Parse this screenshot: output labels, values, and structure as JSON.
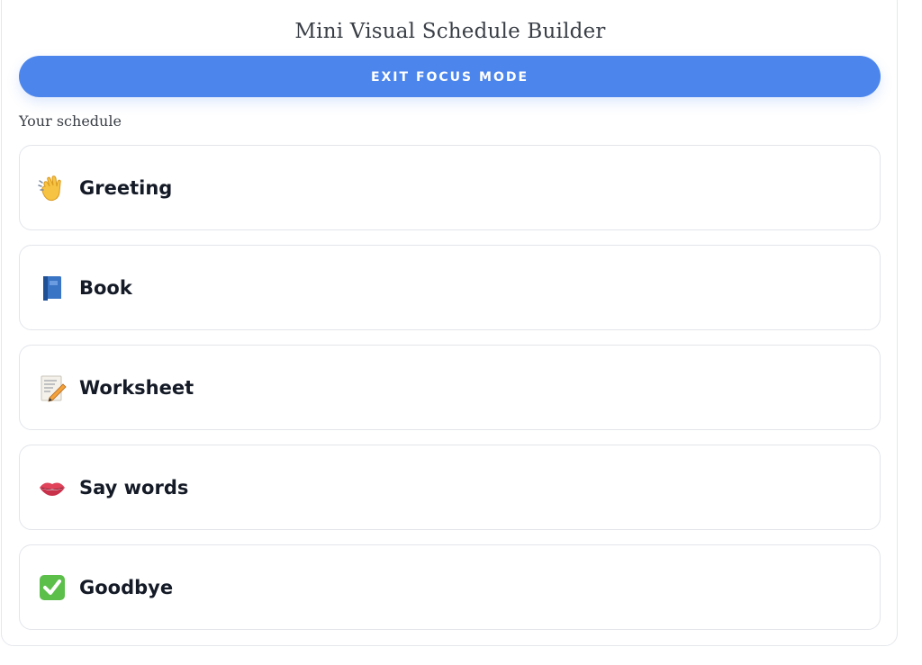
{
  "app": {
    "title": "Mini Visual Schedule Builder"
  },
  "toolbar": {
    "exit_label": "EXIT FOCUS MODE"
  },
  "schedule": {
    "heading": "Your schedule",
    "items": [
      {
        "label": "Greeting",
        "icon": "waving-hand-icon"
      },
      {
        "label": "Book",
        "icon": "blue-book-icon"
      },
      {
        "label": "Worksheet",
        "icon": "memo-pencil-icon"
      },
      {
        "label": "Say words",
        "icon": "lips-icon"
      },
      {
        "label": "Goodbye",
        "icon": "check-mark-icon"
      }
    ]
  },
  "colors": {
    "accent": "#4c86ec",
    "text": "#141a26",
    "border": "#e3e5ea"
  }
}
